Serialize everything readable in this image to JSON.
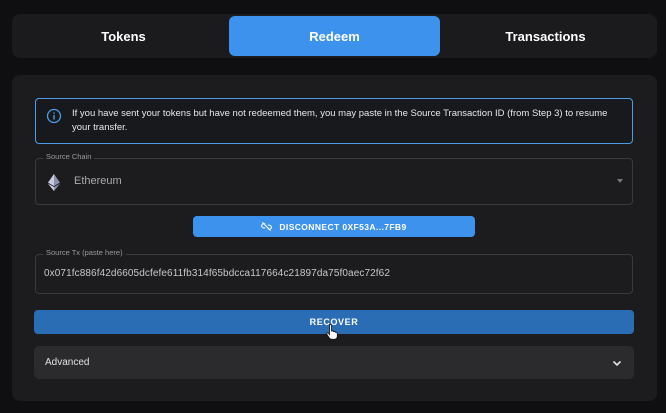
{
  "tabs": [
    {
      "label": "Tokens",
      "active": false
    },
    {
      "label": "Redeem",
      "active": true
    },
    {
      "label": "Transactions",
      "active": false
    }
  ],
  "info": {
    "text": "If you have sent your tokens but have not redeemed them, you may paste in the Source Transaction ID (from Step 3) to resume your transfer.",
    "icon": "info-icon"
  },
  "source_chain": {
    "label": "Source Chain",
    "value": "Ethereum",
    "icon": "ethereum-icon"
  },
  "disconnect_button": {
    "label": "DISCONNECT 0XF53A...7FB9",
    "icon": "unlink-icon"
  },
  "source_tx": {
    "label": "Source Tx (paste here)",
    "value": "0x071fc886f42d6605dcfefe611fb314f65bdcca117664c21897da75f0aec72f62"
  },
  "recover_button": {
    "label": "RECOVER"
  },
  "advanced": {
    "label": "Advanced",
    "icon": "chevron-down-icon"
  },
  "colors": {
    "accent": "#3d92ee",
    "recover": "#2a6db5",
    "background": "#0f0f11",
    "panel": "#1c1c1f"
  }
}
